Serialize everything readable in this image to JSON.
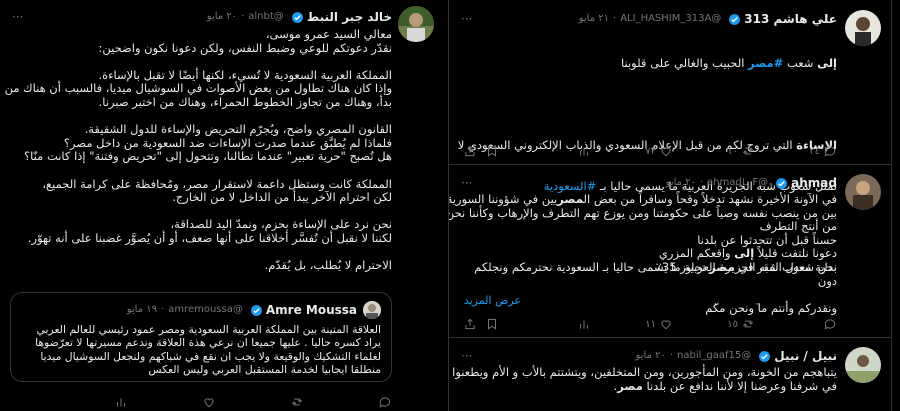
{
  "left_tweet": {
    "name": "خالد جبر النبط",
    "handle": "@alnbt",
    "time": "٢٠ مايو",
    "lines": [
      "معالي السيد عمرو موسى،",
      "نقدّر دعوتكم للوعي وضبط النفس، ولكن دعونا نكون واضحين:",
      "",
      "المملكة العربية السعودية لا تُسيء، لكنها أيضًا لا تقبل بالإساءة.",
      "وإذا كان هناك تطاول من بعض الأصوات في السوشيال ميديا، فالسبب أن هناك من",
      "بدأ، وهناك من تجاوز الخطوط الحمراء، وهناك من اختبر صبرنا.",
      "",
      "القانون المصري واضح، ويُجرّم التحريض والإساءة للدول الشقيقة.",
      "فلماذا لم يُطبَّق عندما صدرت الإساءات ضد السعودية من داخل مصر؟",
      "هل تُصبح \"حرية تعبير\" عندما تطالنا، وتتحول إلى \"تحريض وفتنة\" إذا كانت منّا؟",
      "",
      "المملكة كانت وستظل داعمة لاستقرار مصر، ومُحافظة على كرامة الجميع،",
      "لكن احترام الآخر يبدأ من الداخل لا من الخارج.",
      "",
      "نحن نرد على الإساءة بحزم، ونمدّ اليد للصداقة،",
      "لكننا لا نقبل أن تُفسَّر أخلاقنا على أنها ضعف، أو أن يُصوَّر غضبنا على أنه تهوّر.",
      "",
      "الاحترام لا يُطلب، بل يُقدّم."
    ],
    "quote": {
      "name": "Amre Moussa",
      "handle": "@amremoussa",
      "time": "١٩ مايو",
      "lines": [
        "العلاقة المتينة بين المملكة العربية السعودية ومصر عمود رئيسي للعالم العربي",
        "يراد كسره حاليا . عليها جميعا ان نرعي هذة العلاقة وندعم مسيرتها لا تعرّضوها",
        "لغلماء التشكيك والوقيعة ولا يجب ان نقع في شباكهم ولنجعل السوشيال ميديا",
        "منطلقا ايجابيا لخدمة المستقبل العربي وليس العكس"
      ]
    }
  },
  "right_tweets": [
    {
      "name": "علي هاشم 313",
      "handle": "@ALI_HASHIM_313A",
      "time": "٢١ مايو",
      "first_line": {
        "b1": "إلى",
        "t1": " شعب ",
        "tag": "#مصر",
        "t2": " الحبيب والغالي على قلوبنا"
      },
      "para2": {
        "b1": "الإساءة",
        "t1": " التي تروج لكم من قبل الإعلام السعودي والذباب الإلكتروني السعودي لا"
      },
      "para2_line2": {
        "t1": "تمثل شعوب شبه الجزيرة العربية ما يسمى حاليا بـ ",
        "tag": "#السعودية"
      },
      "para3": [
        "نحن شعوب شبه الجزيرة العربية ما يسمى حاليا بـ السعودية نحترمكم ونجلكم",
        "ونقدركم وأنتم م̈ا ونحن م̈كم"
      ],
      "stats": {
        "replies": "٢٤",
        "retweets": "١٠",
        "likes": "٧٣",
        "views": ""
      }
    },
    {
      "name": "ahmad",
      "handle": "@ahmadL_F",
      "time": "٢٠ مايو",
      "lines": [
        "في الآونة الأخيرة نشهد تدخلاً وقحاً وسافراً من بعض المصريين في شؤوننا السورية",
        "بين من ينصب نفسه وصياً على حكومتنا ومن يوزع تهم التطرف والإرهاب وكأننا نحن",
        "من أنتج التطرف",
        "حسناً قبل أن تتحدثوا عن بلدنا",
        "دعونا نلتفت قليلاً إلى واقعكم المزري",
        "بداية معدل الفقر في مصر تجاوز 35٪",
        "دون"
      ],
      "show_more": "عرض المزيد",
      "stats": {
        "replies": "",
        "retweets": "١٥",
        "likes": "١١",
        "views": ""
      }
    },
    {
      "name": "نبيل / نبيل",
      "handle": "@nabil_gaaf15",
      "time": "٢٠ مايو",
      "lines": [
        "يتباهجم من الخونة، ومن المأجورين، ومن المتخلفين، ويتشتتم بالأب و الأم ويطعنوا",
        "في شرفنا وعرضنا إلا لأننا ندافع عن بلدنا مصر."
      ]
    }
  ],
  "colors": {
    "accent": "#1d9bf0",
    "muted": "#71767b",
    "border": "#2f3336",
    "bg": "#000000",
    "text": "#e7e9ea"
  },
  "icons": [
    "verified-badge-icon",
    "reply-icon",
    "retweet-icon",
    "like-icon",
    "views-icon",
    "bookmark-icon",
    "share-icon"
  ]
}
